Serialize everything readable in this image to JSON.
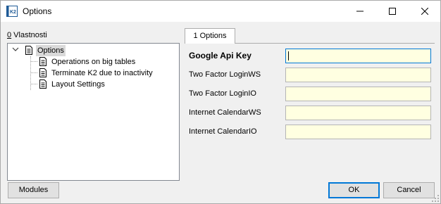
{
  "window": {
    "title": "Options",
    "icon": "k2-app-icon"
  },
  "titlebar_buttons": [
    "minimize",
    "maximize",
    "close"
  ],
  "left_panel": {
    "label_accel": "0",
    "label_text": " Vlastnosti",
    "tree": {
      "root": {
        "label": "Options",
        "expanded": true,
        "selected": true
      },
      "children": [
        {
          "label": "Operations on big tables"
        },
        {
          "label": "Terminate K2 due to inactivity"
        },
        {
          "label": "Layout Settings"
        }
      ]
    }
  },
  "tabs": [
    {
      "label": "1 Options",
      "active": true
    }
  ],
  "form": {
    "fields": [
      {
        "label": "Google Api Key",
        "value": "",
        "bold": true,
        "focused": true
      },
      {
        "label": "Two Factor LoginWS",
        "value": ""
      },
      {
        "label": "Two Factor LoginIO",
        "value": ""
      },
      {
        "label": "Internet CalendarWS",
        "value": ""
      },
      {
        "label": "Internet CalendarIO",
        "value": ""
      }
    ]
  },
  "buttons": {
    "modules": "Modules",
    "ok": "OK",
    "cancel": "Cancel"
  },
  "colors": {
    "input_background": "#ffffe1",
    "focus_accent": "#0078d7",
    "selection": "#d9d9d9"
  }
}
